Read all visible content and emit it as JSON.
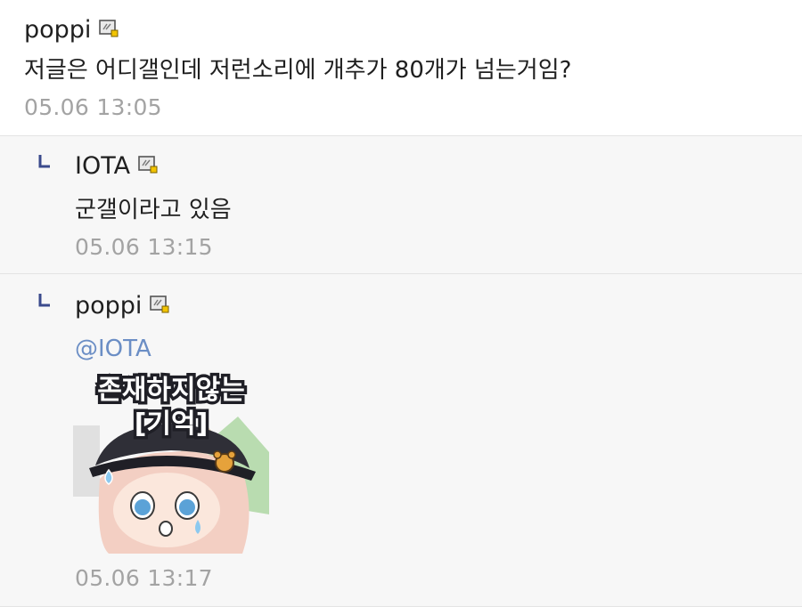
{
  "comments": [
    {
      "nickname": "poppi",
      "text": "저글은 어디갤인데 저런소리에 개추가 80개가 넘는거임?",
      "time": "05.06 13:05"
    },
    {
      "nickname": "IOTA",
      "text": "군갤이라고 있음",
      "time": "05.06 13:15"
    },
    {
      "nickname": "poppi",
      "mention": "@IOTA",
      "time": "05.06 13:17",
      "sticker": {
        "text_line1": "존재하지않는",
        "text_line2": "[기억]"
      }
    }
  ],
  "icons": {
    "gallery_icon": "gallery-nick-icon",
    "reply_mark": "reply-arrow-icon"
  },
  "colors": {
    "mention": "#6b8ec5",
    "time": "#a3a3a3",
    "reply_mark": "#3a4a8c"
  }
}
